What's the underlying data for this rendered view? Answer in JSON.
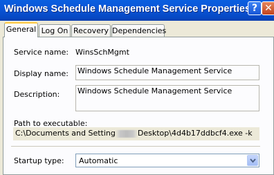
{
  "window": {
    "title": "Windows Schedule Management Service Properties (Lo...",
    "help_glyph": "?",
    "close_glyph": "✕"
  },
  "tabs": [
    {
      "label": "General",
      "active": true
    },
    {
      "label": "Log On",
      "active": false
    },
    {
      "label": "Recovery",
      "active": false
    },
    {
      "label": "Dependencies",
      "active": false
    }
  ],
  "general": {
    "service_name_label": "Service name:",
    "service_name_value": "WinsSchMgmt",
    "display_name_label": "Display name:",
    "display_name_value": "Windows Schedule Management Service",
    "description_label": "Description:",
    "description_value": "Windows Schedule Management Service",
    "path_label": "Path to executable:",
    "path_prefix": "C:\\Documents and Setting",
    "path_suffix": "Desktop\\4d4b17ddbcf4.exe -k",
    "startup_type_label": "Startup type:",
    "startup_type_value": "Automatic"
  },
  "colors": {
    "titlebar": "#0a56d8",
    "tab_highlight": "#ffc83c",
    "dialog_bg": "#ece9d8",
    "close_button": "#c3431c"
  }
}
